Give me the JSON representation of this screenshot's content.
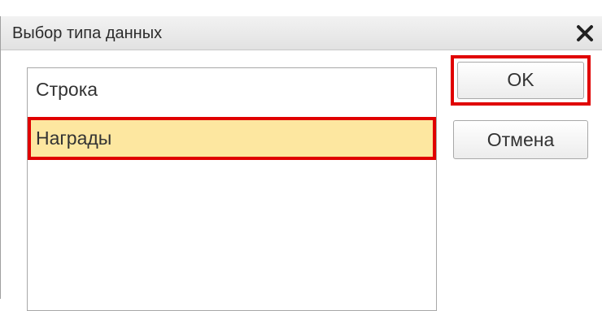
{
  "dialog": {
    "title": "Выбор типа данных",
    "close_icon": "close-icon"
  },
  "list": {
    "items": [
      {
        "label": "Строка",
        "selected": false
      },
      {
        "label": "Награды",
        "selected": true
      }
    ]
  },
  "buttons": {
    "ok_label": "OK",
    "cancel_label": "Отмена"
  },
  "colors": {
    "selection_fill": "#fde7a0",
    "highlight_border": "#e00000"
  }
}
